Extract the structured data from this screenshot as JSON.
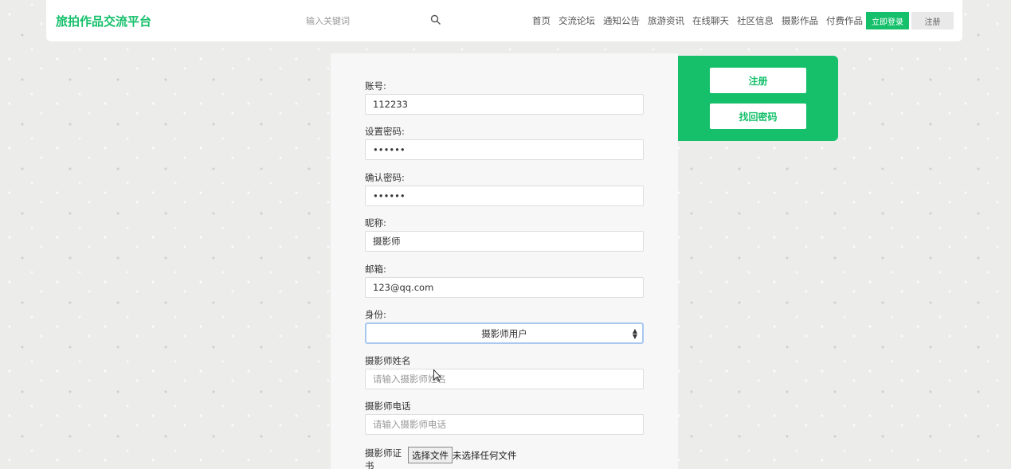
{
  "header": {
    "logo": "旅拍作品交流平台",
    "search_placeholder": "输入关键词",
    "nav": [
      "首页",
      "交流论坛",
      "通知公告",
      "旅游资讯",
      "在线聊天",
      "社区信息",
      "摄影作品",
      "付费作品"
    ],
    "login_label": "立即登录",
    "register_label": "注册"
  },
  "form": {
    "account": {
      "label": "账号:",
      "value": "112233"
    },
    "password": {
      "label": "设置密码:",
      "value": "••••••"
    },
    "confirm_password": {
      "label": "确认密码:",
      "value": "••••••"
    },
    "nickname": {
      "label": "昵称:",
      "value": "摄影师"
    },
    "email": {
      "label": "邮箱:",
      "value": "123@qq.com"
    },
    "identity": {
      "label": "身份:",
      "selected": "摄影师用户"
    },
    "photographer_name": {
      "label": "摄影师姓名",
      "placeholder": "请输入摄影师姓名"
    },
    "photographer_phone": {
      "label": "摄影师电话",
      "placeholder": "请输入摄影师电话"
    },
    "certificate": {
      "label": "摄影师证书",
      "button": "选择文件",
      "status": "未选择任何文件"
    }
  },
  "side": {
    "register_label": "注册",
    "recover_label": "找回密码"
  },
  "colors": {
    "accent": "#16c06b"
  }
}
